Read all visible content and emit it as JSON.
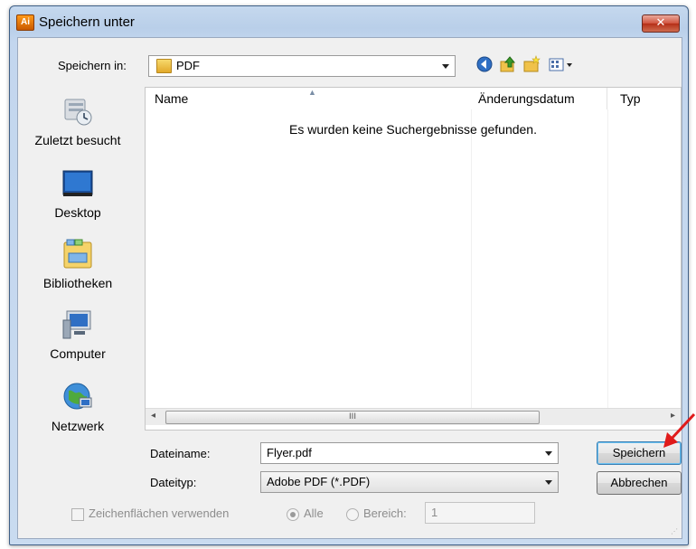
{
  "window": {
    "title": "Speichern unter",
    "app_icon_text": "Ai",
    "close_glyph": "✕"
  },
  "toolbar": {
    "save_in_label": "Speichern in:",
    "location_value": "PDF",
    "icons": [
      "back-icon",
      "up-folder-icon",
      "new-folder-icon",
      "view-menu-icon"
    ]
  },
  "sidebar": {
    "items": [
      {
        "label": "Zuletzt besucht",
        "icon": "recent-places-icon"
      },
      {
        "label": "Desktop",
        "icon": "desktop-icon"
      },
      {
        "label": "Bibliotheken",
        "icon": "libraries-icon"
      },
      {
        "label": "Computer",
        "icon": "computer-icon"
      },
      {
        "label": "Netzwerk",
        "icon": "network-icon"
      }
    ]
  },
  "filelist": {
    "columns": [
      "Name",
      "Änderungsdatum",
      "Typ"
    ],
    "empty_message": "Es wurden keine Suchergebnisse gefunden.",
    "scroll_grip": "III"
  },
  "form": {
    "filename_label": "Dateiname:",
    "filename_value": "Flyer.pdf",
    "filetype_label": "Dateityp:",
    "filetype_value": "Adobe PDF (*.PDF)"
  },
  "buttons": {
    "save": "Speichern",
    "cancel": "Abbrechen"
  },
  "options": {
    "artboards_label": "Zeichenflächen verwenden",
    "all_label": "Alle",
    "range_label": "Bereich:",
    "range_value": "1"
  },
  "colors": {
    "annotation_arrow": "#e01b1b",
    "title_gradient_top": "#c5d8ee",
    "close_button": "#c9452e"
  }
}
